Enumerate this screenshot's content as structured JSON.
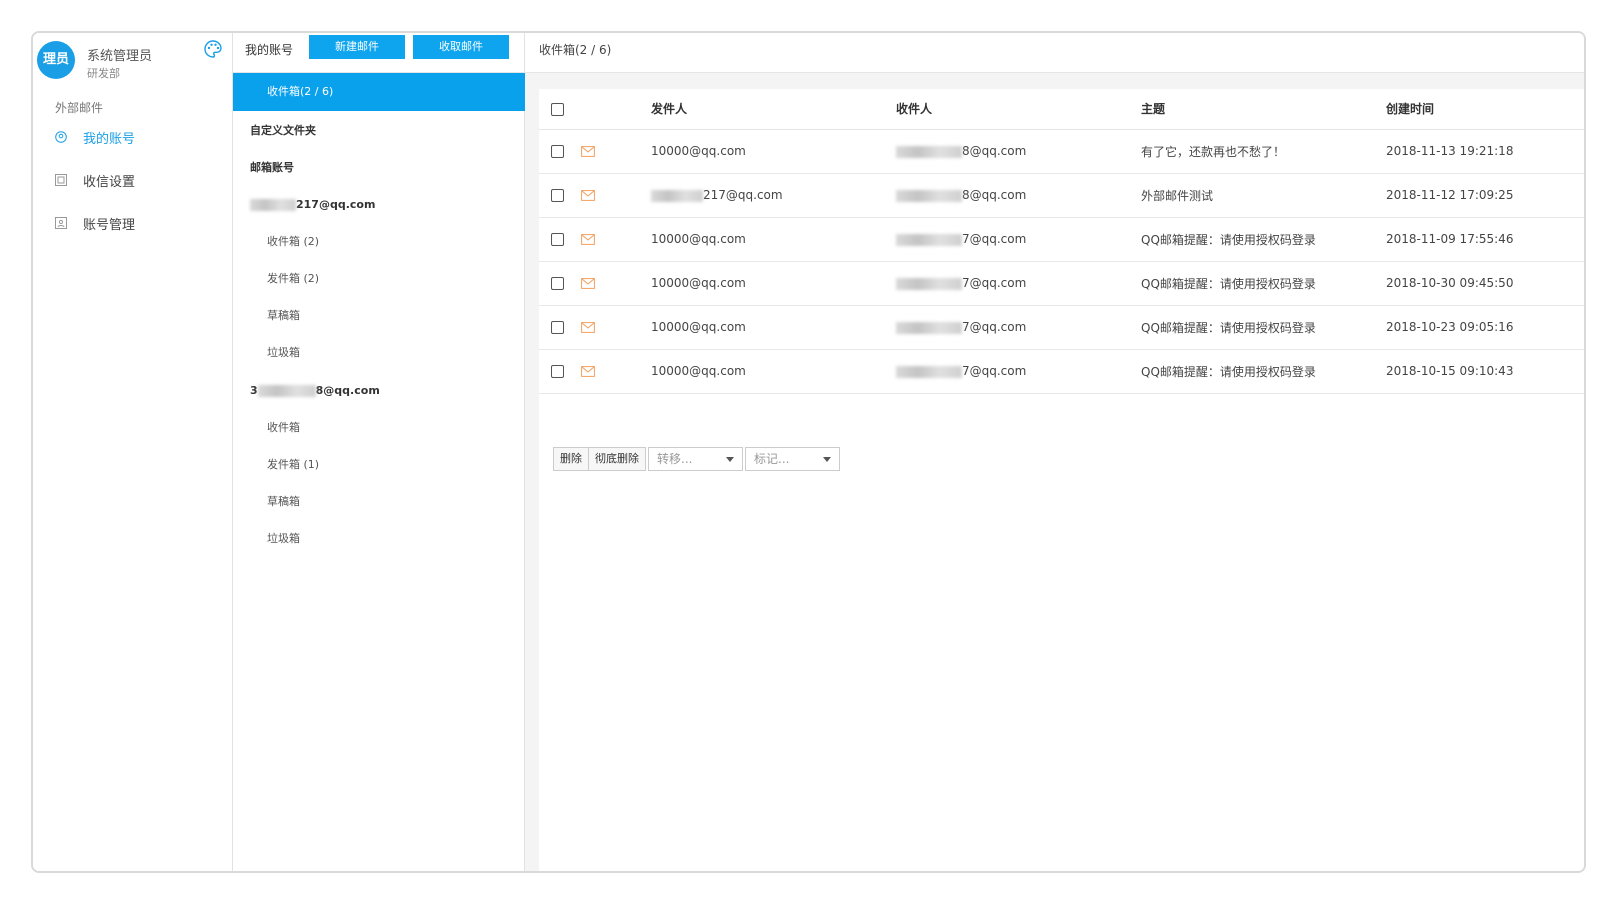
{
  "user": {
    "avatar_text": "理员",
    "name": "系统管理员",
    "dept": "研发部"
  },
  "sidebar": {
    "section": "外部邮件",
    "items": [
      {
        "label": "我的账号",
        "icon": "user-icon",
        "active": true
      },
      {
        "label": "收信设置",
        "icon": "settings-icon",
        "active": false
      },
      {
        "label": "账号管理",
        "icon": "account-icon",
        "active": false
      }
    ]
  },
  "folders": {
    "header": "我的账号",
    "new_mail_button": "新建邮件",
    "receive_mail_button": "收取邮件",
    "active_folder": "收件箱(2 / 6)",
    "custom_folder": "自定义文件夹",
    "mail_accounts": "邮箱账号",
    "account1": {
      "email_suffix": "217@qq.com",
      "subfolders": [
        "收件箱 (2)",
        "发件箱 (2)",
        "草稿箱",
        "垃圾箱"
      ]
    },
    "account2": {
      "email_prefix": "3",
      "email_suffix": "8@qq.com",
      "subfolders": [
        "收件箱",
        "发件箱 (1)",
        "草稿箱",
        "垃圾箱"
      ]
    }
  },
  "main": {
    "title": "收件箱(2 / 6)",
    "columns": {
      "sender": "发件人",
      "recipient": "收件人",
      "subject": "主题",
      "created": "创建时间"
    },
    "rows": [
      {
        "sender": "10000@qq.com",
        "recipient_suffix": "8@qq.com",
        "subject": "有了它，还款再也不愁了！",
        "time": "2018-11-13 19:21:18"
      },
      {
        "sender": "217@qq.com",
        "recipient_suffix": "8@qq.com",
        "subject": "外部邮件测试",
        "time": "2018-11-12 17:09:25"
      },
      {
        "sender": "10000@qq.com",
        "recipient_suffix": "7@qq.com",
        "subject": "QQ邮箱提醒：请使用授权码登录",
        "time": "2018-11-09 17:55:46"
      },
      {
        "sender": "10000@qq.com",
        "recipient_suffix": "7@qq.com",
        "subject": "QQ邮箱提醒：请使用授权码登录",
        "time": "2018-10-30 09:45:50"
      },
      {
        "sender": "10000@qq.com",
        "recipient_suffix": "7@qq.com",
        "subject": "QQ邮箱提醒：请使用授权码登录",
        "time": "2018-10-23 09:05:16"
      },
      {
        "sender": "10000@qq.com",
        "recipient_suffix": "7@qq.com",
        "subject": "QQ邮箱提醒：请使用授权码登录",
        "time": "2018-10-15 09:10:43"
      }
    ],
    "toolbar": {
      "delete": "删除",
      "delete_permanently": "彻底删除",
      "move_to": "转移...",
      "mark": "标记..."
    }
  },
  "colors": {
    "accent": "#0aa1ec",
    "envelope": "#f0a060"
  }
}
